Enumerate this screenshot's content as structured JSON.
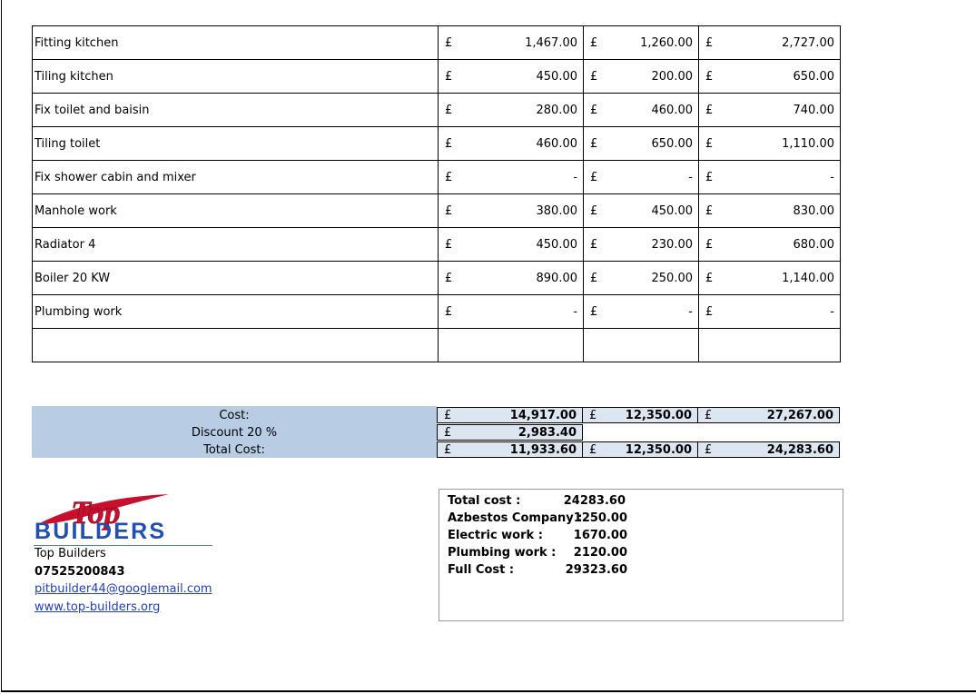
{
  "currency_symbol": "£",
  "rows": [
    {
      "desc": "Fitting kitchen",
      "c1": "1,467.00",
      "c2": "1,260.00",
      "c3": "2,727.00"
    },
    {
      "desc": "Tiling kitchen",
      "c1": "450.00",
      "c2": "200.00",
      "c3": "650.00"
    },
    {
      "desc": "Fix toilet and baisin",
      "c1": "280.00",
      "c2": "460.00",
      "c3": "740.00"
    },
    {
      "desc": "Tiling toilet",
      "c1": "460.00",
      "c2": "650.00",
      "c3": "1,110.00"
    },
    {
      "desc": "Fix shower cabin and mixer",
      "c1": "-",
      "c2": "-",
      "c3": "-"
    },
    {
      "desc": "Manhole work",
      "c1": "380.00",
      "c2": "450.00",
      "c3": "830.00"
    },
    {
      "desc": "Radiator 4",
      "c1": "450.00",
      "c2": "230.00",
      "c3": "680.00"
    },
    {
      "desc": "Boiler 20 KW",
      "c1": "890.00",
      "c2": "250.00",
      "c3": "1,140.00"
    },
    {
      "desc": "Plumbing work",
      "c1": "-",
      "c2": "-",
      "c3": "-"
    }
  ],
  "totals": {
    "cost_label": "Cost:",
    "cost": [
      "14,917.00",
      "12,350.00",
      "27,267.00"
    ],
    "discount_label": "Discount 20 %",
    "discount": "2,983.40",
    "total_label": "Total Cost:",
    "total": [
      "11,933.60",
      "12,350.00",
      "24,283.60"
    ]
  },
  "logo": {
    "top": "Top",
    "bottom": "BUILDERS",
    "red": "#c8102e",
    "blue": "#1f4fb5"
  },
  "contact": {
    "name": "Top Builders",
    "phone": "07525200843",
    "email": "pitbuilder44@googlemail.com",
    "website": "www.top-builders.org"
  },
  "summary": [
    {
      "label": "Total cost :",
      "value": "24283.60"
    },
    {
      "label": "Azbestos Company :",
      "value": "1250.00"
    },
    {
      "label": "Electric work :",
      "value": "1670.00"
    },
    {
      "label": "Plumbing work :",
      "value": "2120.00"
    },
    {
      "label": "Full Cost  :",
      "value": "29323.60"
    }
  ]
}
